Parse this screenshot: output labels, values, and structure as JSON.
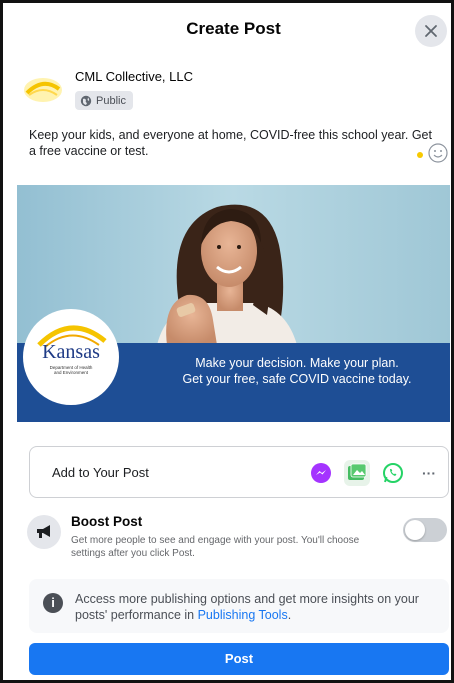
{
  "header": {
    "title": "Create Post"
  },
  "author": {
    "name": "CML Collective, LLC",
    "privacy_label": "Public"
  },
  "post": {
    "text": "Keep your kids, and everyone at home, COVID-free this school year. Get a free vaccine or test."
  },
  "ad": {
    "caption_line1": "Make your decision. Make your plan.",
    "caption_line2": "Get your free, safe COVID vaccine today.",
    "logo_word": "Kansas",
    "logo_sub1": "Department of Health",
    "logo_sub2": "and Environment"
  },
  "add_to_post": {
    "label": "Add to Your Post",
    "icons": [
      "messenger-icon",
      "photo-video-icon",
      "whatsapp-icon",
      "more-icon"
    ],
    "more_label": "···"
  },
  "boost": {
    "title": "Boost Post",
    "description": "Get more people to see and engage with your post. You'll choose settings after you click Post.",
    "enabled": false
  },
  "info": {
    "icon_label": "i",
    "text": "Access more publishing options and get more insights on your posts' performance in ",
    "link": "Publishing Tools",
    "suffix": "."
  },
  "post_button": {
    "label": "Post"
  },
  "colors": {
    "primary": "#1877f2",
    "ad_banner": "#1e4e95",
    "messenger": "#a434ff",
    "whatsapp": "#25d366",
    "photo": "#45bd62"
  }
}
